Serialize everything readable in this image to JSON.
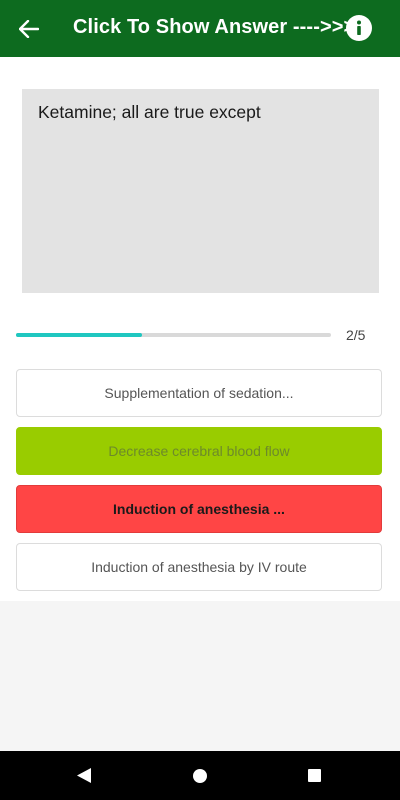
{
  "header": {
    "title": "Click To Show Answer ---->>>",
    "back_icon": "arrow-left-icon",
    "info_icon": "info-icon",
    "bg_color": "#0d6b1f"
  },
  "question": {
    "text": "Ketamine; all are true except"
  },
  "progress": {
    "fraction": 0.4,
    "count_label": "2/5",
    "fill_color": "#1fc7c0"
  },
  "options": [
    {
      "label": "Supplementation of sedation...",
      "state": "default"
    },
    {
      "label": "Decrease cerebral blood flow",
      "state": "correct",
      "color": "#99cc00"
    },
    {
      "label": "Induction of anesthesia ...",
      "state": "wrong",
      "color": "#ff4545"
    },
    {
      "label": "Induction of anesthesia by IV route",
      "state": "default"
    }
  ],
  "system_nav": {
    "back_icon": "triangle-back-icon",
    "home_icon": "circle-home-icon",
    "recents_icon": "square-recents-icon"
  }
}
